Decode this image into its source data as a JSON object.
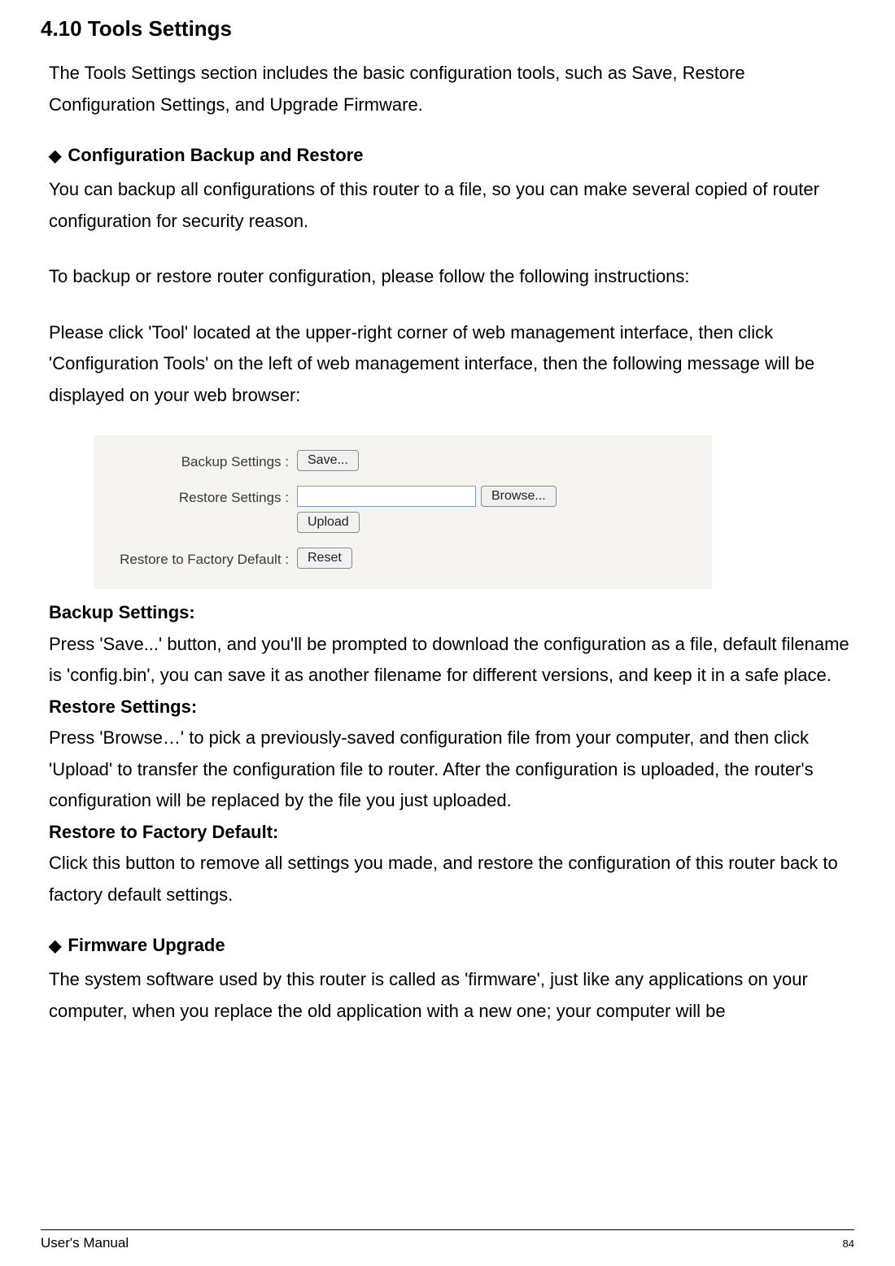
{
  "header": {
    "title": "4.10 Tools Settings"
  },
  "intro": "The Tools Settings section includes the basic configuration tools, such as Save, Restore Configuration Settings, and Upgrade Firmware.",
  "section1": {
    "title": "Configuration Backup and Restore",
    "para1": "You can backup all configurations of this router to a file, so you can make several copied of router configuration for security reason.",
    "para2": "To backup or restore router configuration, please follow the following instructions:",
    "para3": "Please click 'Tool' located at the upper-right corner of web management interface, then click 'Configuration Tools' on the left of web management interface, then the following message will be displayed on your web browser:"
  },
  "panel": {
    "backup_label": "Backup Settings :",
    "restore_label": "Restore Settings :",
    "factory_label": "Restore to Factory Default :",
    "save_btn": "Save...",
    "browse_btn": "Browse...",
    "upload_btn": "Upload",
    "reset_btn": "Reset",
    "file_value": ""
  },
  "definitions": {
    "backup_title": "Backup Settings:",
    "backup_body": "Press 'Save...' button, and you'll be prompted to download the configuration as a file, default filename is 'config.bin', you can save it as another filename for different versions, and keep it in a safe place.",
    "restore_title": "Restore Settings:",
    "restore_body": "Press 'Browse…' to pick a previously-saved configuration file from your computer, and then click 'Upload' to transfer the configuration file to router. After the configuration is uploaded, the router's configuration will be replaced by the file you just uploaded.",
    "factory_title": "Restore to Factory Default:",
    "factory_body": "Click this button to remove all settings you made, and restore the configuration of this router back to factory default settings."
  },
  "section2": {
    "title": "Firmware Upgrade",
    "para1": "The system software used by this router is called as 'firmware', just like any applications on your computer, when you replace the old application with a new one; your computer will be"
  },
  "footer": {
    "left": "User's Manual",
    "page": "84"
  },
  "icons": {
    "diamond": "◆"
  }
}
